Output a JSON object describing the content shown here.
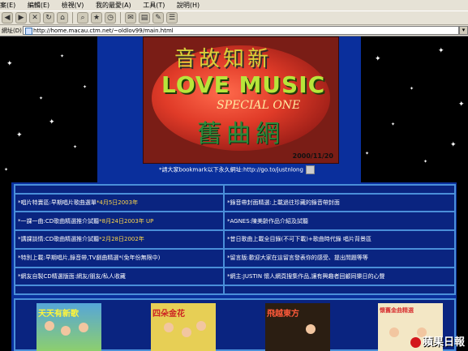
{
  "menu": [
    "案(E)",
    "編輯(E)",
    "檢視(V)",
    "我的最愛(A)",
    "工具(T)",
    "說明(H)"
  ],
  "address": {
    "label": "網址(D)",
    "url": "http://home.macau.ctm.net/~oldlov99/main.html"
  },
  "banner": {
    "line1": "音故知新",
    "line2": "LOVE MUSIC",
    "line3": "SPECIAL ONE",
    "line4": "舊曲網",
    "date": "2000/11/20"
  },
  "bookmark_text": "*請大家bookmark以下永久網址:http://go.to/justnlong",
  "nav_rows": [
    [
      {
        "title": "唱片特賣區",
        "note": ":早期唱片歌曲選單",
        "hl": "*4月5日2003年"
      },
      {
        "title": "錄音帶封面精選",
        "note": ":上載過往珍藏的錄音帶封面",
        "hl": ""
      }
    ],
    [
      {
        "title": "一課一曲",
        "note": ":CD歌曲精選推介試聽",
        "hl": "*8月24日2003年 UP"
      },
      {
        "title": "AGNES",
        "note": ":陳美齡作品介紹及試聽",
        "hl": ""
      }
    ],
    [
      {
        "title": "講課談情",
        "note": ":CD歌曲精選推介試聽",
        "hl": "*2月28日2002年"
      },
      {
        "title": "昔日歌曲上載全目錄",
        "note": "(不可下載)+歌曲時代錄 唱片背景區",
        "hl": ""
      }
    ],
    [
      {
        "title": "特別上載",
        "note": ":早期唱片,錄音帶,TV劇曲精選*(免年份無限中)",
        "hl": ""
      },
      {
        "title": "留言版",
        "note": ":歡迎大家在這留言發表你的感受、提出問題等等",
        "hl": ""
      }
    ],
    [
      {
        "title": "網友自製CD精選版面",
        "note": ":網友/朋友/私人收藏",
        "hl": ""
      },
      {
        "title": "網主",
        "note": ":JUSTIN 懷人網頁搜集作品,讓有興趣者回顧同樂日的心聲",
        "hl": ""
      }
    ]
  ],
  "albums": [
    {
      "label": "天天有新歌"
    },
    {
      "label": "四朵金花"
    },
    {
      "label": "飛越東方"
    },
    {
      "label": "懷舊金曲精選"
    }
  ],
  "watermark": "蘋果日報"
}
